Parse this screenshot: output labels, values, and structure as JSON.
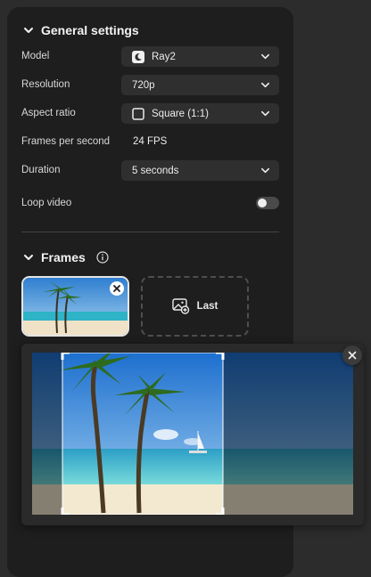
{
  "general": {
    "title": "General settings",
    "rows": {
      "model": {
        "label": "Model",
        "value": "Ray2"
      },
      "resolution": {
        "label": "Resolution",
        "value": "720p"
      },
      "aspect": {
        "label": "Aspect ratio",
        "value": "Square (1:1)"
      },
      "fps": {
        "label": "Frames per second",
        "value": "24 FPS"
      },
      "duration": {
        "label": "Duration",
        "value": "5 seconds"
      },
      "loop": {
        "label": "Loop video",
        "enabled": false
      }
    }
  },
  "frames": {
    "title": "Frames",
    "last_label": "Last"
  },
  "icons": {
    "section_chevron": "chevron-down-icon",
    "model_icon": "moon-icon",
    "aspect_icon": "square-icon",
    "info": "info-icon",
    "add_image": "add-image-icon",
    "close": "close-icon"
  },
  "colors": {
    "panel": "#1e1e1e",
    "control": "#2f2f2f",
    "background": "#2c2c2c"
  }
}
